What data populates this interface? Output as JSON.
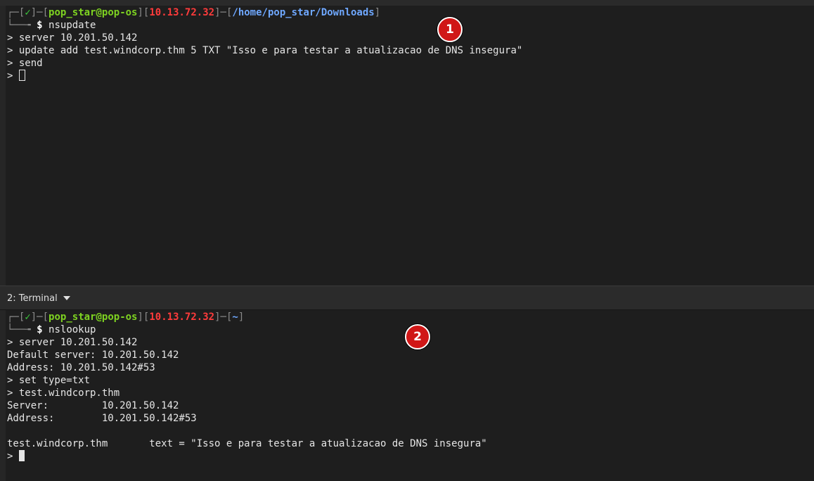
{
  "prompt_glyphs": {
    "top_left": "┌─",
    "bottom_left": "└──╼",
    "bracket_open": "[",
    "bracket_close": "]",
    "dash": "─",
    "check": "✓"
  },
  "pane1": {
    "prompt": {
      "user_host": "pop_star@pop-os",
      "ip": "10.13.72.32",
      "cwd": "/home/pop_star/Downloads"
    },
    "command": "nsupdate",
    "lines": [
      "> server 10.201.50.142",
      "> update add test.windcorp.thm 5 TXT \"Isso e para testar a atualizacao de DNS insegura\"",
      "> send"
    ],
    "input_prompt": "> "
  },
  "tabbar": {
    "tab_label": "2: Terminal"
  },
  "pane2": {
    "prompt": {
      "user_host": "pop_star@pop-os",
      "ip": "10.13.72.32",
      "cwd": "~"
    },
    "command": "nslookup",
    "lines": [
      "> server 10.201.50.142",
      "Default server: 10.201.50.142",
      "Address: 10.201.50.142#53",
      "> set type=txt",
      "> test.windcorp.thm",
      "Server:         10.201.50.142",
      "Address:        10.201.50.142#53",
      "",
      "test.windcorp.thm       text = \"Isso e para testar a atualizacao de DNS insegura\""
    ],
    "input_prompt": "> "
  },
  "markers": {
    "one": "1",
    "two": "2"
  },
  "colors": {
    "background": "#1e1e1e",
    "user_host": "#7ed321",
    "ip": "#ff3b3b",
    "path": "#6fa8ff",
    "check": "#3cc93c",
    "marker": "#d01717"
  }
}
